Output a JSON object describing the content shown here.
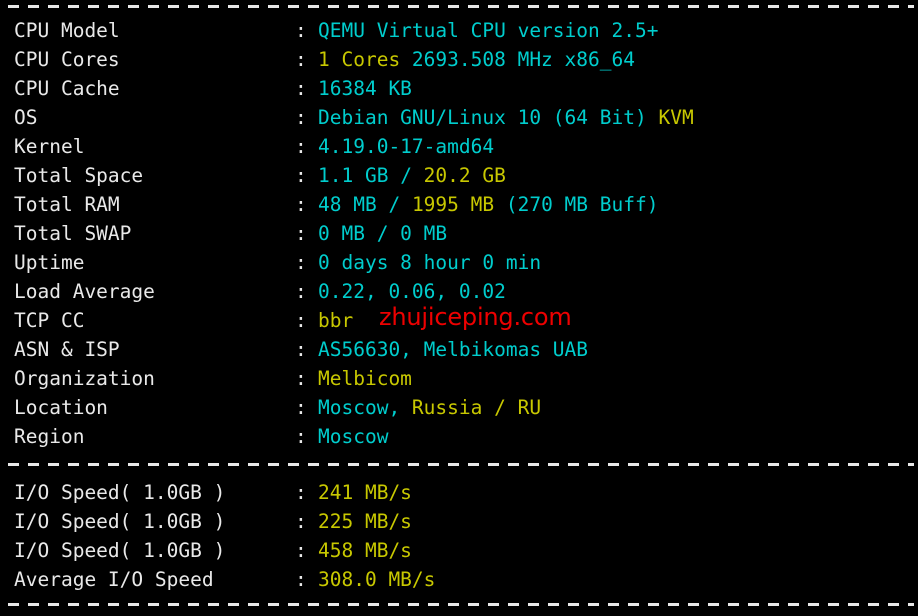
{
  "terminal": {
    "background_color": "#000000",
    "colors": {
      "label": "#e9e9e9",
      "cyan": "#00cdcd",
      "yellow": "#c8c800",
      "white": "#e9e9e9",
      "watermark_red": "#ee0000"
    },
    "separators": {
      "top": "------------------------------------------------------------------------",
      "middle": "------------------------------------------------------------------------",
      "bottom": "------------------------------------------------------------------------"
    },
    "watermark": "zhujiceping.com",
    "system_info": [
      {
        "label": "CPU Model",
        "colon": ":",
        "value": "QEMU Virtual CPU version 2.5+",
        "segments": [
          {
            "text": "QEMU Virtual CPU version 2.5+",
            "color": "cyan"
          }
        ]
      },
      {
        "label": "CPU Cores",
        "colon": ":",
        "value": "1 Cores 2693.508 MHz x86_64",
        "segments": [
          {
            "text": "1 Cores ",
            "color": "yellow"
          },
          {
            "text": "2693.508 MHz x86_64",
            "color": "cyan"
          }
        ]
      },
      {
        "label": "CPU Cache",
        "colon": ":",
        "value": "16384 KB",
        "segments": [
          {
            "text": "16384 KB",
            "color": "cyan"
          }
        ]
      },
      {
        "label": "OS",
        "colon": ":",
        "value": "Debian GNU/Linux 10 (64 Bit) KVM",
        "segments": [
          {
            "text": "Debian GNU/Linux 10 (64 Bit) ",
            "color": "cyan"
          },
          {
            "text": "KVM",
            "color": "yellow"
          }
        ]
      },
      {
        "label": "Kernel",
        "colon": ":",
        "value": "4.19.0-17-amd64",
        "segments": [
          {
            "text": "4.19.0-17-amd64",
            "color": "cyan"
          }
        ]
      },
      {
        "label": "Total Space",
        "colon": ":",
        "value": "1.1 GB / 20.2 GB",
        "segments": [
          {
            "text": "1.1 GB ",
            "color": "cyan"
          },
          {
            "text": "/ ",
            "color": "cyan"
          },
          {
            "text": "20.2 GB",
            "color": "yellow"
          }
        ]
      },
      {
        "label": "Total RAM",
        "colon": ":",
        "value": "48 MB / 1995 MB (270 MB Buff)",
        "segments": [
          {
            "text": "48 MB ",
            "color": "cyan"
          },
          {
            "text": "/ ",
            "color": "cyan"
          },
          {
            "text": "1995 MB ",
            "color": "yellow"
          },
          {
            "text": "(270 MB Buff)",
            "color": "cyan"
          }
        ]
      },
      {
        "label": "Total SWAP",
        "colon": ":",
        "value": "0 MB / 0 MB",
        "segments": [
          {
            "text": "0 MB / 0 MB",
            "color": "cyan"
          }
        ]
      },
      {
        "label": "Uptime",
        "colon": ":",
        "value": "0 days 8 hour 0 min",
        "segments": [
          {
            "text": "0 days 8 hour 0 min",
            "color": "cyan"
          }
        ]
      },
      {
        "label": "Load Average",
        "colon": ":",
        "value": "0.22, 0.06, 0.02",
        "segments": [
          {
            "text": "0.22, 0.06, 0.02",
            "color": "cyan"
          }
        ]
      },
      {
        "label": "TCP CC",
        "colon": ":",
        "value": "bbr",
        "segments": [
          {
            "text": "bbr",
            "color": "yellow"
          }
        ]
      },
      {
        "label": "ASN & ISP",
        "colon": ":",
        "value": "AS56630, Melbikomas UAB",
        "segments": [
          {
            "text": "AS56630, Melbikomas UAB",
            "color": "cyan"
          }
        ]
      },
      {
        "label": "Organization",
        "colon": ":",
        "value": "Melbicom",
        "segments": [
          {
            "text": "Melbicom",
            "color": "yellow"
          }
        ]
      },
      {
        "label": "Location",
        "colon": ":",
        "value": "Moscow, Russia / RU",
        "segments": [
          {
            "text": "Moscow, ",
            "color": "cyan"
          },
          {
            "text": "Russia / RU",
            "color": "yellow"
          }
        ]
      },
      {
        "label": "Region",
        "colon": ":",
        "value": "Moscow",
        "segments": [
          {
            "text": "Moscow",
            "color": "cyan"
          }
        ]
      }
    ],
    "io_results": [
      {
        "label": "I/O Speed( 1.0GB )",
        "colon": ":",
        "value": "241 MB/s",
        "segments": [
          {
            "text": "241 MB/s",
            "color": "yellow"
          }
        ]
      },
      {
        "label": "I/O Speed( 1.0GB )",
        "colon": ":",
        "value": "225 MB/s",
        "segments": [
          {
            "text": "225 MB/s",
            "color": "yellow"
          }
        ]
      },
      {
        "label": "I/O Speed( 1.0GB )",
        "colon": ":",
        "value": "458 MB/s",
        "segments": [
          {
            "text": "458 MB/s",
            "color": "yellow"
          }
        ]
      },
      {
        "label": "Average I/O Speed",
        "colon": ":",
        "value": "308.0 MB/s",
        "segments": [
          {
            "text": "308.0 MB/s",
            "color": "yellow"
          }
        ]
      }
    ]
  }
}
